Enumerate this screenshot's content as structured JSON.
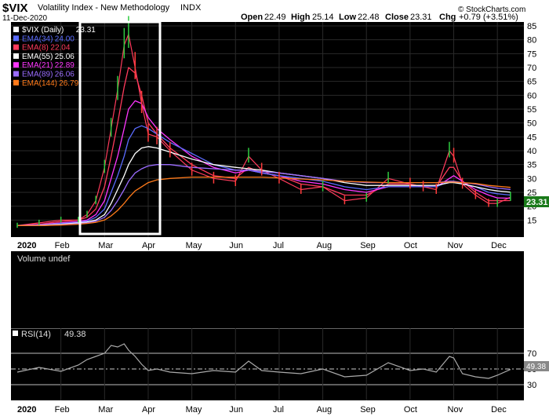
{
  "header": {
    "symbol": "$VIX",
    "name": "Volatility Index - New Methodology",
    "exchange": "INDX",
    "date": "11-Dec-2020",
    "open_label": "Open",
    "open": "22.49",
    "high_label": "High",
    "high": "25.14",
    "low_label": "Low",
    "low": "22.48",
    "close_label": "Close",
    "close": "23.31",
    "chg_label": "Chg",
    "chg": "+0.79 (+3.51%)",
    "watermark": "© StockCharts.com"
  },
  "price_panel": {
    "legend": [
      {
        "label": "$VIX (Daily)",
        "value": "23.31",
        "color": "#ffffff"
      },
      {
        "label": "EMA(34)",
        "value": "24.00",
        "color": "#5b6cff"
      },
      {
        "label": "EMA(8)",
        "value": "22.04",
        "color": "#ff3b5c"
      },
      {
        "label": "EMA(55)",
        "value": "25.06",
        "color": "#ffffff"
      },
      {
        "label": "EMA(21)",
        "value": "22.89",
        "color": "#ff36ff"
      },
      {
        "label": "EMA(89)",
        "value": "26.06",
        "color": "#9b6cff"
      },
      {
        "label": "EMA(144)",
        "value": "26.79",
        "color": "#ff7a1a"
      }
    ],
    "last_price_tag": "23.31"
  },
  "volume_panel": {
    "label": "Volume undef"
  },
  "rsi_panel": {
    "label": "RSI(14)",
    "value": "49.38",
    "last_tag": "49.38"
  },
  "x_axis": {
    "labels": [
      "2020",
      "Feb",
      "Mar",
      "Apr",
      "May",
      "Jun",
      "Jul",
      "Aug",
      "Sep",
      "Oct",
      "Nov",
      "Dec"
    ]
  },
  "chart_data": [
    {
      "type": "line",
      "panel": "price",
      "ylim": [
        10,
        85
      ],
      "y_ticks": [
        15,
        20,
        25,
        30,
        35,
        40,
        45,
        50,
        55,
        60,
        65,
        70,
        75,
        80,
        85
      ],
      "x_months": [
        "2020",
        "Feb",
        "Mar",
        "Apr",
        "May",
        "Jun",
        "Jul",
        "Aug",
        "Sep",
        "Oct",
        "Nov",
        "Dec"
      ],
      "x": [
        0,
        0.5,
        1,
        1.4,
        1.6,
        1.8,
        2,
        2.15,
        2.3,
        2.45,
        2.55,
        2.7,
        2.85,
        3,
        3.2,
        3.5,
        4,
        4.5,
        5,
        5.3,
        5.6,
        6,
        6.5,
        7,
        7.5,
        8,
        8.5,
        9,
        9.3,
        9.6,
        9.9,
        10,
        10.2,
        10.5,
        10.8,
        11,
        11.3
      ],
      "series": [
        {
          "name": "$VIX (Daily)",
          "color": "#ff3b5c",
          "values": [
            13,
            14,
            15,
            15,
            17,
            22,
            34,
            48,
            62,
            78,
            82,
            70,
            57,
            46,
            45,
            40,
            33,
            30,
            29,
            38,
            33,
            30,
            26,
            27,
            22,
            23,
            30,
            28,
            27,
            26,
            40,
            38,
            28,
            24,
            21,
            21,
            23.31
          ]
        },
        {
          "name": "EMA(8)",
          "color": "#ff3b5c",
          "values": [
            13,
            13.5,
            14.5,
            15,
            16,
            19,
            27,
            38,
            50,
            63,
            70,
            68,
            60,
            50,
            46,
            41,
            35,
            31,
            30,
            34,
            32,
            31,
            28,
            27,
            24,
            24,
            28,
            28,
            27,
            27,
            34,
            34,
            29,
            25,
            22,
            22,
            22.04
          ]
        },
        {
          "name": "EMA(21)",
          "color": "#ff36ff",
          "values": [
            13,
            13.3,
            14,
            14.5,
            15,
            17,
            22,
            30,
            38,
            48,
            55,
            58,
            57,
            52,
            48,
            44,
            38,
            34,
            32,
            33,
            32,
            31,
            29,
            28,
            26,
            25,
            27,
            27,
            27,
            27,
            30,
            31,
            29,
            26,
            24,
            23,
            22.89
          ]
        },
        {
          "name": "EMA(34)",
          "color": "#5b6cff",
          "values": [
            13,
            13.2,
            13.8,
            14.2,
            14.6,
            16,
            19,
            25,
            31,
            38,
            44,
            48,
            49,
            48,
            46,
            43,
            39,
            35,
            33,
            33,
            32,
            31,
            30,
            29,
            27,
            26,
            27,
            27,
            27,
            27,
            29,
            29,
            28,
            27,
            25,
            24.5,
            24.0
          ]
        },
        {
          "name": "EMA(55)",
          "color": "#ffffff",
          "values": [
            13,
            13.1,
            13.5,
            14,
            14.3,
            15,
            17,
            21,
            26,
            31,
            35,
            39,
            41,
            41.5,
            41,
            39.5,
            37,
            35,
            34,
            33.5,
            33,
            32,
            31,
            30,
            28.5,
            27.5,
            27.5,
            27.5,
            27.5,
            27.5,
            28.5,
            28.5,
            28,
            27,
            26,
            25.5,
            25.06
          ]
        },
        {
          "name": "EMA(89)",
          "color": "#9b6cff",
          "values": [
            13,
            13,
            13.3,
            13.7,
            14,
            14.6,
            16,
            18.5,
            22,
            26,
            29,
            32,
            33.5,
            34.5,
            35,
            35,
            34,
            33.5,
            33,
            33,
            32.5,
            32,
            31,
            30,
            29,
            28.5,
            28.5,
            28.5,
            28.5,
            28.5,
            29,
            29,
            28.5,
            28,
            27,
            26.5,
            26.06
          ]
        },
        {
          "name": "EMA(144)",
          "color": "#ff7a1a",
          "values": [
            13,
            13,
            13.2,
            13.5,
            13.8,
            14.2,
            15,
            16.5,
            18.5,
            21,
            23,
            25.5,
            27,
            28.5,
            29.5,
            30,
            30.5,
            30.5,
            30.5,
            30.5,
            30.5,
            30.2,
            29.8,
            29.5,
            29,
            28.7,
            28.5,
            28.5,
            28.5,
            28.5,
            28.7,
            28.7,
            28.5,
            28.2,
            27.5,
            27.2,
            26.79
          ]
        }
      ]
    },
    {
      "type": "line",
      "panel": "rsi",
      "ylim": [
        10,
        100
      ],
      "y_ticks": [
        30,
        50,
        70
      ],
      "x": [
        0,
        0.5,
        1,
        1.4,
        1.6,
        1.8,
        2,
        2.15,
        2.3,
        2.45,
        2.55,
        2.7,
        2.85,
        3,
        3.2,
        3.5,
        4,
        4.5,
        5,
        5.3,
        5.6,
        6,
        6.5,
        7,
        7.5,
        8,
        8.5,
        9,
        9.3,
        9.6,
        9.9,
        10,
        10.2,
        10.5,
        10.8,
        11,
        11.3
      ],
      "series": [
        {
          "name": "RSI(14)",
          "color": "#aaaaaa",
          "values": [
            46,
            52,
            47,
            55,
            62,
            66,
            70,
            80,
            78,
            82,
            74,
            66,
            56,
            48,
            50,
            46,
            44,
            48,
            46,
            60,
            48,
            46,
            44,
            50,
            40,
            42,
            58,
            48,
            50,
            46,
            66,
            64,
            44,
            40,
            38,
            42,
            49.38
          ]
        }
      ]
    }
  ]
}
